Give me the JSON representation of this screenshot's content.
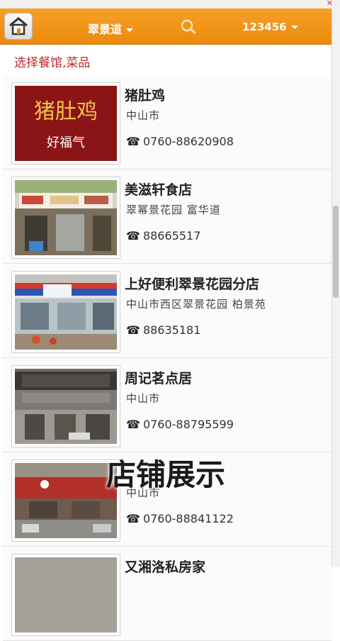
{
  "header": {
    "area": "翠景道",
    "user": "123456"
  },
  "prompt": "选择餐馆,菜品",
  "restaurants": [
    {
      "name": "猪肚鸡",
      "address": "中山市",
      "phone": "0760-88620908",
      "logo_main": "猪肚鸡",
      "logo_sub": "好福气"
    },
    {
      "name": "美滋轩食店",
      "address": "翠幂景花园 富华道",
      "phone": "88665517"
    },
    {
      "name": "上好便利翠景花园分店",
      "address": "中山市西区翠景花园 柏景苑",
      "phone": "88635181"
    },
    {
      "name": "周记茗点居",
      "address": "中山市",
      "phone": "0760-88795599"
    },
    {
      "name": "",
      "address": "中山市",
      "phone": "0760-88841122"
    },
    {
      "name": "又湘洛私房家",
      "address": "",
      "phone": ""
    }
  ],
  "watermark": "店铺展示",
  "colors": {
    "header": "#ef8f14",
    "prompt": "#c0282d"
  }
}
